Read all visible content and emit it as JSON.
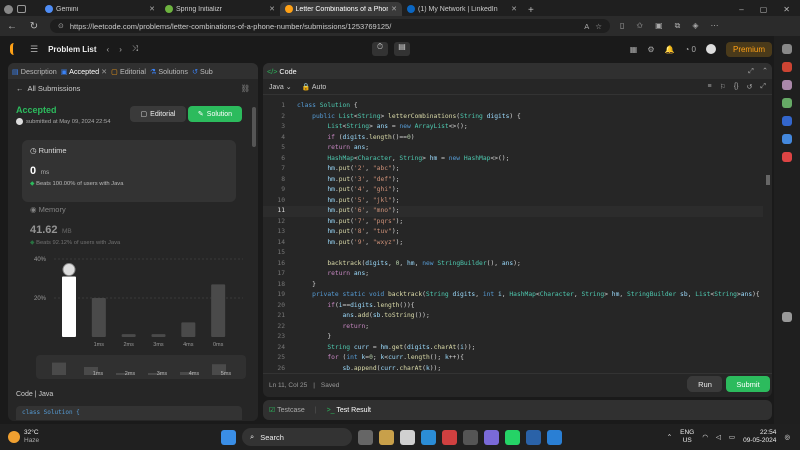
{
  "browser": {
    "tabs": [
      {
        "label": "Gemini",
        "color": "#4f8df5"
      },
      {
        "label": "Spring Initializr",
        "color": "#6db33f"
      },
      {
        "label": "Letter Combinations of a Phone",
        "color": "#ffa116",
        "active": true
      },
      {
        "label": "(1) My Network | LinkedIn",
        "color": "#0a66c2"
      }
    ],
    "url": "https://leetcode.com/problems/letter-combinations-of-a-phone-number/submissions/1253769125/"
  },
  "header": {
    "problem_list": "Problem List",
    "streak": "0",
    "premium": "Premium"
  },
  "left": {
    "tabs": [
      "Description",
      "Accepted",
      "Editorial",
      "Solutions",
      "Sub"
    ],
    "all_submissions": "All Submissions",
    "status": "Accepted",
    "submitted": "submitted at May 09, 2024 22:54",
    "editorial_btn": "Editorial",
    "solution_btn": "Solution",
    "runtime_label": "Runtime",
    "runtime_value": "0",
    "runtime_unit": "ms",
    "runtime_beats": "Beats 100.00% of users with Java",
    "memory_label": "Memory",
    "memory_value": "41.62",
    "memory_unit": "MB",
    "memory_beats": "Beats 92.12% of users with Java",
    "code_label": "Code",
    "code_lang": "Java",
    "code_preview": "class Solution {"
  },
  "chart_data": {
    "type": "bar",
    "categories": [
      "0ms",
      "1ms",
      "2ms",
      "3ms",
      "4ms",
      "5ms"
    ],
    "ytick_labels": [
      "40%",
      "20%"
    ],
    "xtick_labels": [
      "1ms",
      "2ms",
      "3ms",
      "4ms",
      "0ms"
    ],
    "values": [
      31,
      20,
      1.5,
      1.5,
      7.5,
      27
    ],
    "highlight_index": 0,
    "ylim": [
      0,
      40
    ],
    "mini_labels": [
      "1ms",
      "2ms",
      "3ms",
      "4ms",
      "5ms"
    ],
    "colors": {
      "highlight": "#ffffff",
      "bar": "#4a4a4a"
    }
  },
  "code": {
    "title": "Code",
    "lang": "Java",
    "mode": "Auto",
    "status": "Ln 11, Col 25",
    "saved": "Saved",
    "run": "Run",
    "submit": "Submit",
    "lines": [
      [
        [
          "kw",
          "class "
        ],
        [
          "ty",
          "Solution "
        ],
        [
          "pl",
          "{"
        ]
      ],
      [
        [
          "pl",
          "    "
        ],
        [
          "kw",
          "public "
        ],
        [
          "ty",
          "List"
        ],
        [
          "pl",
          "<"
        ],
        [
          "ty",
          "String"
        ],
        [
          "pl",
          "> "
        ],
        [
          "fn",
          "letterCombinations"
        ],
        [
          "pl",
          "("
        ],
        [
          "ty",
          "String "
        ],
        [
          "vr",
          "digits"
        ],
        [
          "pl",
          ") {"
        ]
      ],
      [
        [
          "pl",
          "        "
        ],
        [
          "ty",
          "List"
        ],
        [
          "pl",
          "<"
        ],
        [
          "ty",
          "String"
        ],
        [
          "pl",
          "> "
        ],
        [
          "vr",
          "ans "
        ],
        [
          "pl",
          "= "
        ],
        [
          "kw",
          "new "
        ],
        [
          "ty",
          "ArrayList"
        ],
        [
          "pl",
          "<>();"
        ]
      ],
      [
        [
          "pl",
          "        "
        ],
        [
          "pk",
          "if "
        ],
        [
          "pl",
          "("
        ],
        [
          "vr",
          "digits"
        ],
        [
          "pl",
          "."
        ],
        [
          "fn",
          "length"
        ],
        [
          "pl",
          "()=="
        ],
        [
          "nm",
          "0"
        ],
        [
          "pl",
          ")"
        ]
      ],
      [
        [
          "pl",
          "        "
        ],
        [
          "pk",
          "return "
        ],
        [
          "vr",
          "ans"
        ],
        [
          "pl",
          ";"
        ]
      ],
      [
        [
          "pl",
          "        "
        ],
        [
          "ty",
          "HashMap"
        ],
        [
          "pl",
          "<"
        ],
        [
          "ty",
          "Character"
        ],
        [
          "pl",
          ", "
        ],
        [
          "ty",
          "String"
        ],
        [
          "pl",
          "> "
        ],
        [
          "vr",
          "hm "
        ],
        [
          "pl",
          "= "
        ],
        [
          "kw",
          "new "
        ],
        [
          "ty",
          "HashMap"
        ],
        [
          "pl",
          "<>();"
        ]
      ],
      [
        [
          "pl",
          "        "
        ],
        [
          "vr",
          "hm"
        ],
        [
          "pl",
          "."
        ],
        [
          "fn",
          "put"
        ],
        [
          "pl",
          "("
        ],
        [
          "st",
          "'2'"
        ],
        [
          "pl",
          ", "
        ],
        [
          "st",
          "\"abc\""
        ],
        [
          "pl",
          ");"
        ]
      ],
      [
        [
          "pl",
          "        "
        ],
        [
          "vr",
          "hm"
        ],
        [
          "pl",
          "."
        ],
        [
          "fn",
          "put"
        ],
        [
          "pl",
          "("
        ],
        [
          "st",
          "'3'"
        ],
        [
          "pl",
          ", "
        ],
        [
          "st",
          "\"def\""
        ],
        [
          "pl",
          ");"
        ]
      ],
      [
        [
          "pl",
          "        "
        ],
        [
          "vr",
          "hm"
        ],
        [
          "pl",
          "."
        ],
        [
          "fn",
          "put"
        ],
        [
          "pl",
          "("
        ],
        [
          "st",
          "'4'"
        ],
        [
          "pl",
          ", "
        ],
        [
          "st",
          "\"ghi\""
        ],
        [
          "pl",
          ");"
        ]
      ],
      [
        [
          "pl",
          "        "
        ],
        [
          "vr",
          "hm"
        ],
        [
          "pl",
          "."
        ],
        [
          "fn",
          "put"
        ],
        [
          "pl",
          "("
        ],
        [
          "st",
          "'5'"
        ],
        [
          "pl",
          ", "
        ],
        [
          "st",
          "\"jkl\""
        ],
        [
          "pl",
          ");"
        ]
      ],
      [
        [
          "pl",
          "        "
        ],
        [
          "vr",
          "hm"
        ],
        [
          "pl",
          "."
        ],
        [
          "fn",
          "put"
        ],
        [
          "pl",
          "("
        ],
        [
          "st",
          "'6'"
        ],
        [
          "pl",
          ", "
        ],
        [
          "st",
          "\"mno\""
        ],
        [
          "pl",
          ");"
        ]
      ],
      [
        [
          "pl",
          "        "
        ],
        [
          "vr",
          "hm"
        ],
        [
          "pl",
          "."
        ],
        [
          "fn",
          "put"
        ],
        [
          "pl",
          "("
        ],
        [
          "st",
          "'7'"
        ],
        [
          "pl",
          ", "
        ],
        [
          "st",
          "\"pqrs\""
        ],
        [
          "pl",
          ");"
        ]
      ],
      [
        [
          "pl",
          "        "
        ],
        [
          "vr",
          "hm"
        ],
        [
          "pl",
          "."
        ],
        [
          "fn",
          "put"
        ],
        [
          "pl",
          "("
        ],
        [
          "st",
          "'8'"
        ],
        [
          "pl",
          ", "
        ],
        [
          "st",
          "\"tuv\""
        ],
        [
          "pl",
          ");"
        ]
      ],
      [
        [
          "pl",
          "        "
        ],
        [
          "vr",
          "hm"
        ],
        [
          "pl",
          "."
        ],
        [
          "fn",
          "put"
        ],
        [
          "pl",
          "("
        ],
        [
          "st",
          "'9'"
        ],
        [
          "pl",
          ", "
        ],
        [
          "st",
          "\"wxyz\""
        ],
        [
          "pl",
          ");"
        ]
      ],
      [
        [
          "pl",
          ""
        ]
      ],
      [
        [
          "pl",
          "        "
        ],
        [
          "fn",
          "backtrack"
        ],
        [
          "pl",
          "("
        ],
        [
          "vr",
          "digits"
        ],
        [
          "pl",
          ", "
        ],
        [
          "nm",
          "0"
        ],
        [
          "pl",
          ", "
        ],
        [
          "vr",
          "hm"
        ],
        [
          "pl",
          ", "
        ],
        [
          "kw",
          "new "
        ],
        [
          "ty",
          "StringBuilder"
        ],
        [
          "pl",
          "(), "
        ],
        [
          "vr",
          "ans"
        ],
        [
          "pl",
          ");"
        ]
      ],
      [
        [
          "pl",
          "        "
        ],
        [
          "pk",
          "return "
        ],
        [
          "vr",
          "ans"
        ],
        [
          "pl",
          ";"
        ]
      ],
      [
        [
          "pl",
          "    }"
        ]
      ],
      [
        [
          "pl",
          "    "
        ],
        [
          "kw",
          "private static void "
        ],
        [
          "fn",
          "backtrack"
        ],
        [
          "pl",
          "("
        ],
        [
          "ty",
          "String "
        ],
        [
          "vr",
          "digits"
        ],
        [
          "pl",
          ", "
        ],
        [
          "kw",
          "int "
        ],
        [
          "vr",
          "i"
        ],
        [
          "pl",
          ", "
        ],
        [
          "ty",
          "HashMap"
        ],
        [
          "pl",
          "<"
        ],
        [
          "ty",
          "Character"
        ],
        [
          "pl",
          ", "
        ],
        [
          "ty",
          "String"
        ],
        [
          "pl",
          "> "
        ],
        [
          "vr",
          "hm"
        ],
        [
          "pl",
          ", "
        ],
        [
          "ty",
          "StringBuilder "
        ],
        [
          "vr",
          "sb"
        ],
        [
          "pl",
          ", "
        ],
        [
          "ty",
          "List"
        ],
        [
          "pl",
          "<"
        ],
        [
          "ty",
          "String"
        ],
        [
          "pl",
          ">"
        ],
        [
          "vr",
          "ans"
        ],
        [
          "pl",
          "){"
        ]
      ],
      [
        [
          "pl",
          "        "
        ],
        [
          "pk",
          "if"
        ],
        [
          "pl",
          "("
        ],
        [
          "vr",
          "i"
        ],
        [
          "pl",
          "=="
        ],
        [
          "vr",
          "digits"
        ],
        [
          "pl",
          "."
        ],
        [
          "fn",
          "length"
        ],
        [
          "pl",
          "()){"
        ]
      ],
      [
        [
          "pl",
          "            "
        ],
        [
          "vr",
          "ans"
        ],
        [
          "pl",
          "."
        ],
        [
          "fn",
          "add"
        ],
        [
          "pl",
          "("
        ],
        [
          "vr",
          "sb"
        ],
        [
          "pl",
          "."
        ],
        [
          "fn",
          "toString"
        ],
        [
          "pl",
          "());"
        ]
      ],
      [
        [
          "pl",
          "            "
        ],
        [
          "pk",
          "return"
        ],
        [
          "pl",
          ";"
        ]
      ],
      [
        [
          "pl",
          "        }"
        ]
      ],
      [
        [
          "pl",
          "        "
        ],
        [
          "ty",
          "String "
        ],
        [
          "vr",
          "curr "
        ],
        [
          "pl",
          "= "
        ],
        [
          "vr",
          "hm"
        ],
        [
          "pl",
          "."
        ],
        [
          "fn",
          "get"
        ],
        [
          "pl",
          "("
        ],
        [
          "vr",
          "digits"
        ],
        [
          "pl",
          "."
        ],
        [
          "fn",
          "charAt"
        ],
        [
          "pl",
          "("
        ],
        [
          "vr",
          "i"
        ],
        [
          "pl",
          "));"
        ]
      ],
      [
        [
          "pl",
          "        "
        ],
        [
          "pk",
          "for "
        ],
        [
          "pl",
          "("
        ],
        [
          "kw",
          "int "
        ],
        [
          "vr",
          "k"
        ],
        [
          "pl",
          "="
        ],
        [
          "nm",
          "0"
        ],
        [
          "pl",
          "; "
        ],
        [
          "vr",
          "k"
        ],
        [
          "pl",
          "<"
        ],
        [
          "vr",
          "curr"
        ],
        [
          "pl",
          "."
        ],
        [
          "fn",
          "length"
        ],
        [
          "pl",
          "(); "
        ],
        [
          "vr",
          "k"
        ],
        [
          "pl",
          "++){"
        ]
      ],
      [
        [
          "pl",
          "            "
        ],
        [
          "vr",
          "sb"
        ],
        [
          "pl",
          "."
        ],
        [
          "fn",
          "append"
        ],
        [
          "pl",
          "("
        ],
        [
          "vr",
          "curr"
        ],
        [
          "pl",
          "."
        ],
        [
          "fn",
          "charAt"
        ],
        [
          "pl",
          "("
        ],
        [
          "vr",
          "k"
        ],
        [
          "pl",
          "));"
        ]
      ],
      [
        [
          "pl",
          "            "
        ],
        [
          "fn",
          "backtrack"
        ],
        [
          "pl",
          "("
        ],
        [
          "vr",
          "digits"
        ],
        [
          "pl",
          ", "
        ],
        [
          "vr",
          "i"
        ],
        [
          "pl",
          "+"
        ],
        [
          "nm",
          "1"
        ],
        [
          "pl",
          ", "
        ],
        [
          "vr",
          "hm"
        ],
        [
          "pl",
          ", "
        ],
        [
          "vr",
          "sb"
        ],
        [
          "pl",
          ", "
        ],
        [
          "vr",
          "ans"
        ],
        [
          "pl",
          ");"
        ]
      ],
      [
        [
          "pl",
          "            "
        ],
        [
          "vr",
          "sb"
        ],
        [
          "pl",
          "."
        ],
        [
          "fn",
          "deleteCharAt"
        ],
        [
          "pl",
          "("
        ],
        [
          "vr",
          "sb"
        ],
        [
          "pl",
          "."
        ],
        [
          "fn",
          "length"
        ],
        [
          "pl",
          "()-"
        ],
        [
          "nm",
          "1"
        ],
        [
          "pl",
          ");"
        ]
      ],
      [
        [
          "pl",
          "        }"
        ]
      ]
    ]
  },
  "bottom": {
    "testcase": "Testcase",
    "test_result": "Test Result"
  },
  "taskbar": {
    "weather_temp": "32°C",
    "weather_desc": "Haze",
    "search": "Search",
    "lang": "ENG",
    "region": "US",
    "time": "22:54",
    "date": "09-05-2024"
  }
}
